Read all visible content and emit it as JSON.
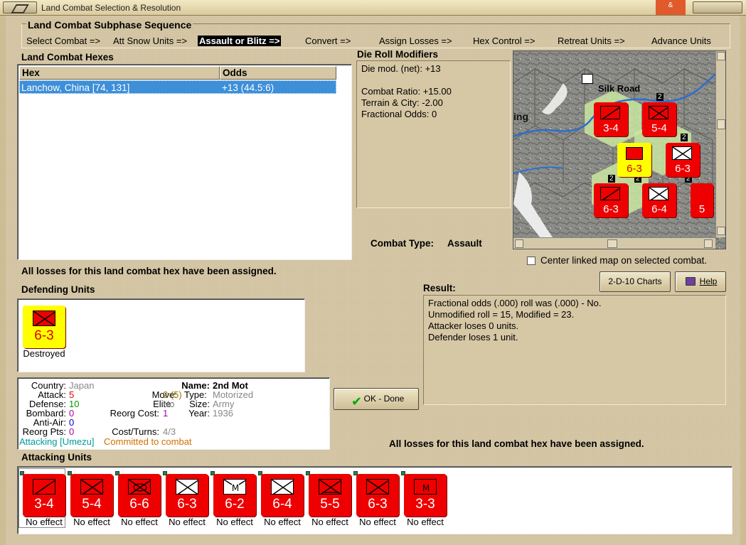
{
  "window": {
    "title": "Land Combat Selection & Resolution",
    "close_glyph": "&"
  },
  "subphase": {
    "title": "Land Combat Subphase Sequence",
    "steps": [
      "Select Combat =>",
      "Att Snow Units =>",
      "Assault or Blitz =>",
      "Convert =>",
      "Assign Losses =>",
      "Hex Control =>",
      "Retreat Units =>",
      "Advance Units"
    ],
    "active_index": 2
  },
  "hexes": {
    "title": "Land Combat Hexes",
    "columns": [
      "Hex",
      "Odds"
    ],
    "rows": [
      [
        "Lanchow, China [74, 131]",
        "+13 (44.5:6)"
      ]
    ]
  },
  "modifiers": {
    "title": "Die Roll Modifiers",
    "lines": [
      "Die mod. (net): +13",
      "",
      "Combat Ratio: +15.00",
      "Terrain & City: -2.00",
      "Fractional Odds: 0"
    ]
  },
  "combat_type": {
    "label": "Combat Type:",
    "value": "Assault"
  },
  "map": {
    "place_label": "Silk Road",
    "partial_label": "ing",
    "stack_counts": [
      "2",
      "2",
      "2",
      "2",
      "2"
    ],
    "units": [
      {
        "num": "3-4",
        "symbol": "armor"
      },
      {
        "num": "5-4",
        "symbol": "infantry"
      },
      {
        "num": "6-3",
        "symbol": "white-inf"
      },
      {
        "num": "6-3",
        "symbol": "armor"
      },
      {
        "num": "6-4",
        "symbol": "white-inf"
      },
      {
        "num": "5",
        "symbol": "armor"
      }
    ],
    "center_counter": "6-3",
    "accent_colors": {
      "hex_green": "#c9e6a0",
      "river": "#2a6fd0",
      "counter_red": "#e00000",
      "counter_yellow": "#ffff00"
    }
  },
  "center_map_checkbox": {
    "label": "Center linked map on selected combat.",
    "checked": false
  },
  "losses_msg_top": "All losses for this land combat hex have been assigned.",
  "buttons": {
    "charts": "2-D-10 Charts",
    "help": "Help",
    "ok": "OK - Done"
  },
  "defending": {
    "title": "Defending Units",
    "units": [
      {
        "num": "6-3",
        "status": "Destroyed",
        "symbol": "infantry",
        "bg": "#ffff00"
      }
    ]
  },
  "result": {
    "title": "Result:",
    "lines": [
      "Fractional odds (.000) roll was (.000)  - No.",
      "Unmodified roll = 15, Modified = 23.",
      "Attacker loses 0 units.",
      "Defender loses 1 unit."
    ]
  },
  "unit_info": {
    "country_label": "Country:",
    "country": "Japan",
    "attack_label": "Attack:",
    "attack": "5",
    "defense_label": "Defense:",
    "defense": "10",
    "bombard_label": "Bombard:",
    "bombard": "0",
    "antiair_label": "Anti-Air:",
    "antiair": "0",
    "reorg_pts_label": "Reorg Pts:",
    "reorg_pts": "0",
    "name_label": "Name:",
    "name": "2nd Mot",
    "move_label": "Move:",
    "move": "2 (5)",
    "type_label": "Type:",
    "type": "Motorized",
    "elite_label": "Elite:",
    "elite": "No",
    "size_label": "Size:",
    "size": "Army",
    "reorg_cost_label": "Reorg Cost:",
    "reorg_cost": "1",
    "year_label": "Year:",
    "year": "1936",
    "cost_label": "Cost/Turns:",
    "cost": "4/3",
    "attacking": "Attacking [Umezu]",
    "committed": "Committed to combat"
  },
  "losses_msg_bottom": "All losses for this land combat hex have been assigned.",
  "attacking": {
    "title": "Attacking Units",
    "units": [
      {
        "num": "3-4",
        "status": "No effect",
        "symbol": "armor"
      },
      {
        "num": "5-4",
        "status": "No effect",
        "symbol": "armor"
      },
      {
        "num": "6-6",
        "status": "No effect",
        "symbol": "armor-x"
      },
      {
        "num": "6-3",
        "status": "No effect",
        "symbol": "white-inf"
      },
      {
        "num": "6-2",
        "status": "No effect",
        "symbol": "white-m",
        "mark": "M"
      },
      {
        "num": "6-4",
        "status": "No effect",
        "symbol": "white-inf"
      },
      {
        "num": "5-5",
        "status": "No effect",
        "symbol": "para"
      },
      {
        "num": "6-3",
        "status": "No effect",
        "symbol": "infantry"
      },
      {
        "num": "3-3",
        "status": "No effect",
        "symbol": "m",
        "mark": "M"
      }
    ]
  }
}
